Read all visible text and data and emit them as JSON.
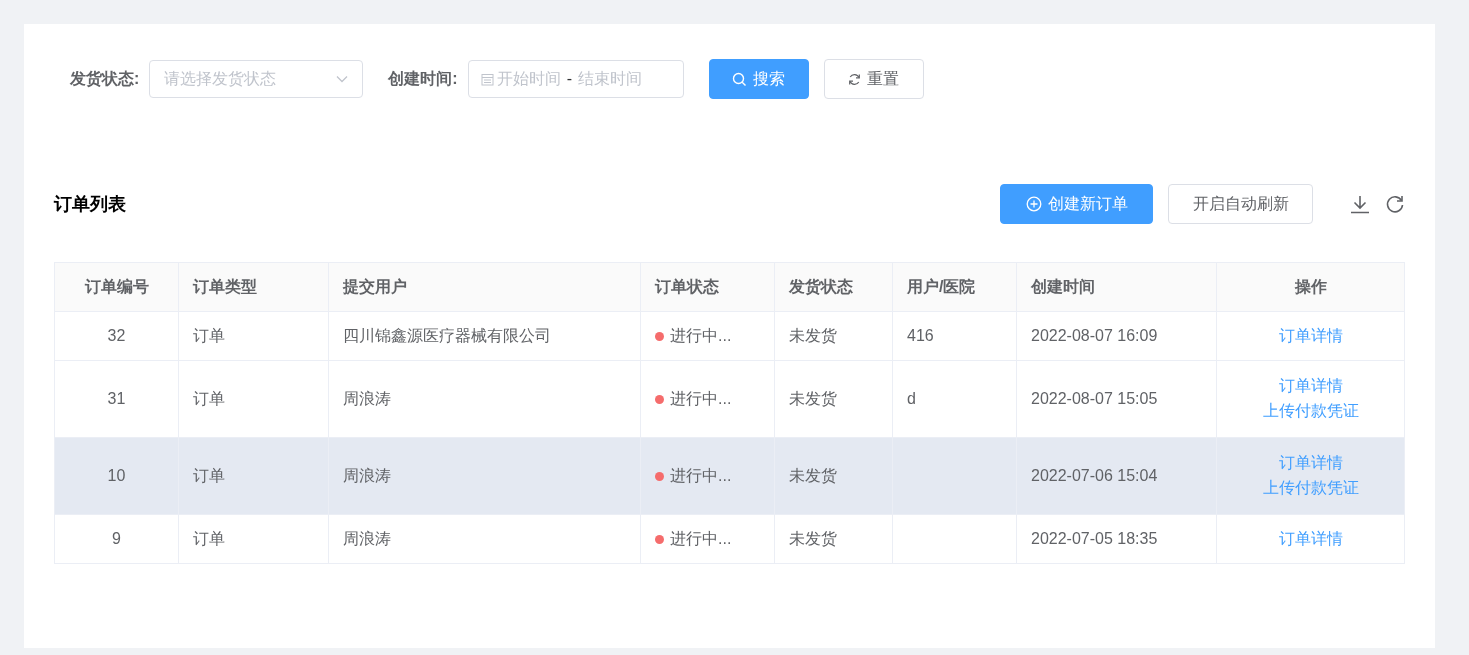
{
  "filters": [
    {
      "kind": "select",
      "label": "发货状态:",
      "placeholder": "请选择发货状态"
    },
    {
      "kind": "daterange",
      "label": "创建时间:",
      "start_placeholder": "开始时间",
      "separator": "-",
      "end_placeholder": "结束时间"
    }
  ],
  "search_button": "搜索",
  "reset_button": "重置",
  "list": {
    "title": "订单列表",
    "create_button": "创建新订单",
    "auto_refresh_button": "开启自动刷新"
  },
  "table": {
    "columns": [
      "订单编号",
      "订单类型",
      "提交用户",
      "订单状态",
      "发货状态",
      "用户/医院",
      "创建时间",
      "操作"
    ],
    "rows": [
      {
        "hovered": false,
        "id": "32",
        "type": "订单",
        "user": "四川锦鑫源医疗器械有限公司",
        "status": "进行中...",
        "color": "#f56c6c",
        "shipping": "未发货",
        "hospital": "416",
        "created": "2022-08-07 16:09",
        "actions": [
          "订单详情"
        ]
      },
      {
        "hovered": false,
        "id": "31",
        "type": "订单",
        "user": "周浪涛",
        "status": "进行中...",
        "color": "#f56c6c",
        "shipping": "未发货",
        "hospital": "d",
        "created": "2022-08-07 15:05",
        "actions": [
          "订单详情",
          "上传付款凭证"
        ]
      },
      {
        "hovered": true,
        "id": "10",
        "type": "订单",
        "user": "周浪涛",
        "status": "进行中...",
        "color": "#f56c6c",
        "shipping": "未发货",
        "hospital": "",
        "created": "2022-07-06 15:04",
        "actions": [
          "订单详情",
          "上传付款凭证"
        ]
      },
      {
        "hovered": false,
        "id": "9",
        "type": "订单",
        "user": "周浪涛",
        "status": "进行中...",
        "color": "#f56c6c",
        "shipping": "未发货",
        "hospital": "",
        "created": "2022-07-05 18:35",
        "actions": [
          "订单详情"
        ]
      }
    ]
  }
}
